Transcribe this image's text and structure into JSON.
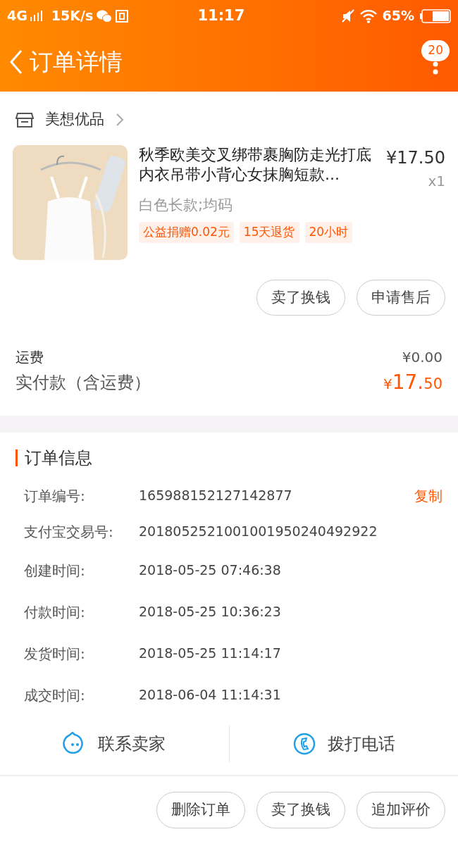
{
  "status_bar": {
    "network": "4G",
    "speed": "15K/s",
    "time": "11:17",
    "battery": "65%"
  },
  "header": {
    "title": "订单详情",
    "badge": "20"
  },
  "shop": {
    "name": "美想优品"
  },
  "product": {
    "kind": "picture",
    "title": "秋季欧美交叉绑带裹胸防走光打底内衣吊带小背心女抹胸短款...",
    "price": "¥17.50",
    "quantity": "x1",
    "sku": "白色长款;均码",
    "tags": [
      "公益捐赠0.02元",
      "15天退货",
      "20小时"
    ],
    "actions": [
      "卖了换钱",
      "申请售后"
    ]
  },
  "fees": [
    {
      "label": "运费",
      "value": "¥0.00",
      "kind": "plain"
    },
    {
      "label": "实付款（含运费）",
      "value_symbol": "¥",
      "value_main": "17.",
      "value_cents": "50",
      "kind": "total"
    }
  ],
  "order_info": {
    "title": "订单信息",
    "rows": [
      {
        "label": "订单编号:",
        "value": "165988152127142877",
        "action": "复制"
      },
      {
        "label": "支付宝交易号:",
        "value": "2018052521001001950240492922"
      },
      {
        "label": "创建时间:",
        "value": "2018-05-25 07:46:38"
      },
      {
        "label": "付款时间:",
        "value": "2018-05-25 10:36:23"
      },
      {
        "label": "发货时间:",
        "value": "2018-05-25 11:14:17"
      },
      {
        "label": "成交时间:",
        "value": "2018-06-04 11:14:31"
      }
    ]
  },
  "contact": [
    {
      "label": "联系卖家",
      "kind": "chat"
    },
    {
      "label": "拨打电话",
      "kind": "phone"
    }
  ],
  "bottom_actions": [
    "删除订单",
    "卖了换钱",
    "追加评价"
  ]
}
